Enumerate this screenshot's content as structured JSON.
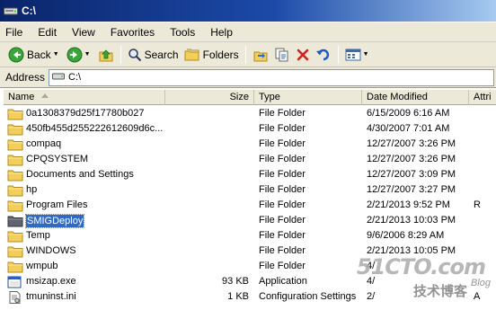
{
  "window": {
    "title": "C:\\"
  },
  "menu": {
    "items": [
      {
        "label": "File"
      },
      {
        "label": "Edit"
      },
      {
        "label": "View"
      },
      {
        "label": "Favorites"
      },
      {
        "label": "Tools"
      },
      {
        "label": "Help"
      }
    ]
  },
  "toolbar": {
    "back_label": "Back",
    "search_label": "Search",
    "folders_label": "Folders"
  },
  "address": {
    "label": "Address",
    "value": "C:\\"
  },
  "columns": {
    "name": "Name",
    "size": "Size",
    "type": "Type",
    "date": "Date Modified",
    "attr": "Attri"
  },
  "files": [
    {
      "name": "0a1308379d25f17780b027",
      "size": "",
      "type": "File Folder",
      "date": "6/15/2009 6:16 AM",
      "attr": "",
      "icon": "folder-icon"
    },
    {
      "name": "450fb455d255222612609d6c...",
      "size": "",
      "type": "File Folder",
      "date": "4/30/2007 7:01 AM",
      "attr": "",
      "icon": "folder-icon"
    },
    {
      "name": "compaq",
      "size": "",
      "type": "File Folder",
      "date": "12/27/2007 3:26 PM",
      "attr": "",
      "icon": "folder-icon"
    },
    {
      "name": "CPQSYSTEM",
      "size": "",
      "type": "File Folder",
      "date": "12/27/2007 3:26 PM",
      "attr": "",
      "icon": "folder-icon"
    },
    {
      "name": "Documents and Settings",
      "size": "",
      "type": "File Folder",
      "date": "12/27/2007 3:09 PM",
      "attr": "",
      "icon": "folder-icon"
    },
    {
      "name": "hp",
      "size": "",
      "type": "File Folder",
      "date": "12/27/2007 3:27 PM",
      "attr": "",
      "icon": "folder-icon"
    },
    {
      "name": "Program Files",
      "size": "",
      "type": "File Folder",
      "date": "2/21/2013 9:52 PM",
      "attr": "R",
      "icon": "folder-icon"
    },
    {
      "name": "SMIGDeploy",
      "size": "",
      "type": "File Folder",
      "date": "2/21/2013 10:03 PM",
      "attr": "",
      "icon": "folder-icon",
      "selected": true
    },
    {
      "name": "Temp",
      "size": "",
      "type": "File Folder",
      "date": "9/6/2006 8:29 AM",
      "attr": "",
      "icon": "folder-icon"
    },
    {
      "name": "WINDOWS",
      "size": "",
      "type": "File Folder",
      "date": "2/21/2013 10:05 PM",
      "attr": "",
      "icon": "folder-icon"
    },
    {
      "name": "wmpub",
      "size": "",
      "type": "File Folder",
      "date": "4/",
      "attr": "",
      "icon": "folder-icon"
    },
    {
      "name": "msizap.exe",
      "size": "93 KB",
      "type": "Application",
      "date": "4/",
      "attr": "",
      "icon": "exe-icon"
    },
    {
      "name": "tmuninst.ini",
      "size": "1 KB",
      "type": "Configuration Settings",
      "date": "2/",
      "attr": "A",
      "icon": "ini-icon"
    }
  ],
  "watermark": {
    "big": "51CTO.com",
    "small": "技术博客",
    "blog": "Blog"
  },
  "colors": {
    "titlebar": "#0a246a",
    "chrome": "#ece9d8",
    "selection": "#316ac5",
    "folder": "#f2cf5b"
  }
}
